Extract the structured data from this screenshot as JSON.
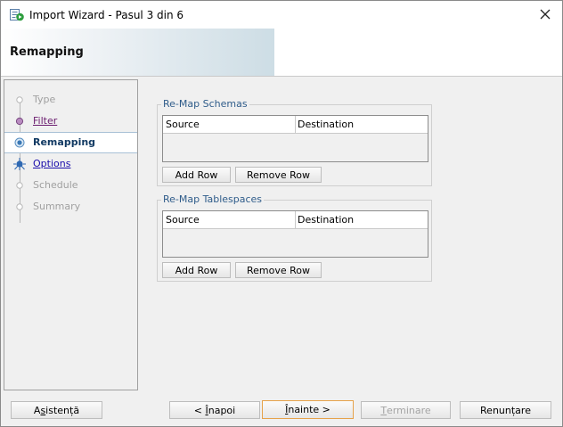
{
  "window": {
    "title": "Import Wizard - Pasul 3 din 6"
  },
  "header": {
    "title": "Remapping"
  },
  "steps": [
    {
      "label": "Type"
    },
    {
      "label": "Filter"
    },
    {
      "label": "Remapping"
    },
    {
      "label": "Options"
    },
    {
      "label": "Schedule"
    },
    {
      "label": "Summary"
    }
  ],
  "schemas": {
    "legend": "Re-Map Schemas",
    "col_source": "Source",
    "col_destination": "Destination",
    "add_row": "Add Row",
    "remove_row": "Remove Row"
  },
  "tablespaces": {
    "legend": "Re-Map Tablespaces",
    "col_source": "Source",
    "col_destination": "Destination",
    "add_row": "Add Row",
    "remove_row": "Remove Row"
  },
  "footer": {
    "help": {
      "mnemonic": "s",
      "after": "istență",
      "before": "A"
    },
    "back": {
      "before": "< ",
      "mnemonic": "Î",
      "after": "napoi"
    },
    "next": {
      "before": "",
      "mnemonic": "Î",
      "after": "nainte >"
    },
    "finish": {
      "before": "",
      "mnemonic": "T",
      "after": "erminare"
    },
    "cancel": {
      "label": "Renunțare"
    }
  },
  "colors": {
    "accent_focus": "#e6a24a",
    "legend": "#2f5c8a",
    "current_step": "#123a63"
  }
}
